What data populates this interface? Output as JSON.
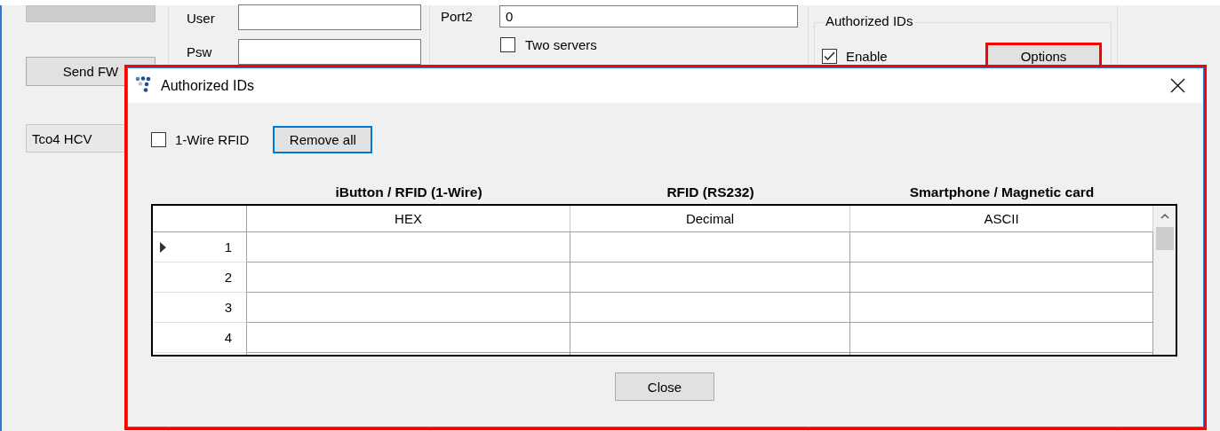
{
  "background": {
    "top_button": {
      "disabled": true
    },
    "send_button": {
      "label": "Send FW"
    },
    "device_field": {
      "value": "Tco4 HCV"
    },
    "user": {
      "label": "User"
    },
    "password": {
      "label": "Psw"
    },
    "port2": {
      "label": "Port2",
      "value": "0"
    },
    "two_servers": {
      "label": "Two servers",
      "checked": false
    },
    "authorized_group": {
      "title": "Authorized IDs",
      "enable": {
        "label": "Enable",
        "checked": true
      },
      "options_button": {
        "label": "Options",
        "highlighted": true
      }
    }
  },
  "dialog": {
    "title": "Authorized IDs",
    "highlighted": true,
    "one_wire": {
      "label": "1-Wire RFID",
      "checked": false
    },
    "remove_all_button": {
      "label": "Remove all",
      "focused": true
    },
    "column_groups": [
      "iButton / RFID (1-Wire)",
      "RFID (RS232)",
      "Smartphone / Magnetic card"
    ],
    "columns": [
      "HEX",
      "Decimal",
      "ASCII"
    ],
    "rows": [
      {
        "number": "1",
        "current": true
      },
      {
        "number": "2",
        "current": false
      },
      {
        "number": "3",
        "current": false
      },
      {
        "number": "4",
        "current": false
      }
    ],
    "close_button": {
      "label": "Close"
    }
  }
}
